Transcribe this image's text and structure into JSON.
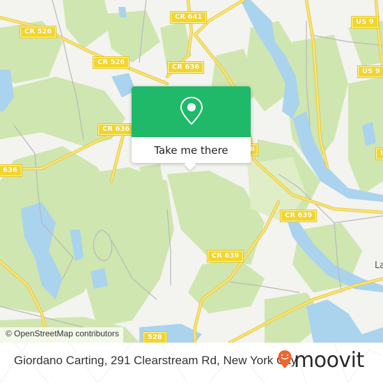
{
  "map": {
    "colors": {
      "land": "#f3f3ef",
      "forest": "#cfe6b0",
      "water": "#aad3ee",
      "road_major": "#f5dc5a",
      "road_minor": "#b8b8b8",
      "shield": "#f3d62b"
    },
    "road_shields": [
      {
        "id": "cr526-west",
        "label": "CR 526"
      },
      {
        "id": "cr526-center",
        "label": "CR 526"
      },
      {
        "id": "cr641",
        "label": "CR 641"
      },
      {
        "id": "cr636-north",
        "label": "CR 636"
      },
      {
        "id": "cr636-center",
        "label": "CR 636"
      },
      {
        "id": "cr636-west",
        "label": "636"
      },
      {
        "id": "us9-north",
        "label": "US 9"
      },
      {
        "id": "us9-center",
        "label": "US 9"
      },
      {
        "id": "us9-east",
        "label": "U"
      },
      {
        "id": "cr639-east",
        "label": "CR 639"
      },
      {
        "id": "cr639-south",
        "label": "CR 639"
      },
      {
        "id": "cr528",
        "label": "528"
      },
      {
        "id": "cr-edge",
        "label": "6"
      }
    ],
    "place_labels": [
      {
        "id": "la",
        "label": "La"
      }
    ],
    "attribution": "© OpenStreetMap contributors"
  },
  "popup": {
    "icon": "map-pin-icon",
    "button_label": "Take me there",
    "accent_color": "#20b96a"
  },
  "footer": {
    "address": "Giordano Carting, 291 Clearstream Rd, New York City",
    "logo_icon": "moovit-pin-icon",
    "logo_text": "moovit",
    "logo_color": "#f0642d"
  }
}
